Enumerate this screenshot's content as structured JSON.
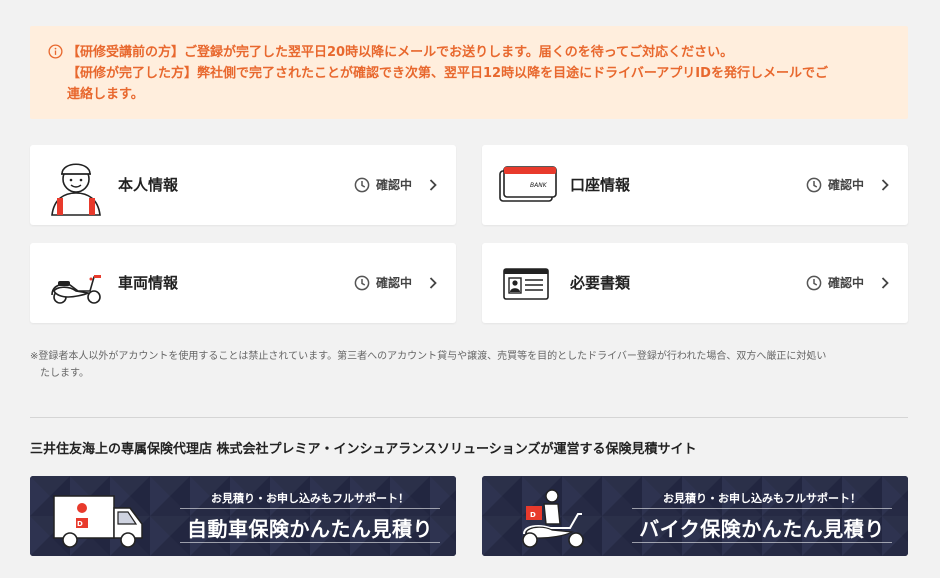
{
  "notice": {
    "lines": [
      "【研修受講前の方】ご登録が完了した翌平日20時以降にメールでお送りします。届くのを待ってご対応ください。",
      "【研修が完了した方】弊社側で完了されたことが確認でき次第、翌平日12時以降を目途にドライバーアプリIDを発行しメールでご",
      "連絡します。"
    ],
    "color": "#e8682e",
    "background": "#ffeedd"
  },
  "cards": [
    {
      "title": "本人情報",
      "status": "確認中",
      "icon": "driver-person-icon"
    },
    {
      "title": "口座情報",
      "status": "確認中",
      "icon": "bank-card-icon"
    },
    {
      "title": "車両情報",
      "status": "確認中",
      "icon": "scooter-icon"
    },
    {
      "title": "必要書類",
      "status": "確認中",
      "icon": "id-card-icon"
    }
  ],
  "disclaimer": {
    "line1": "※登録者本人以外がアカウントを使用することは禁止されています。第三者へのアカウント貸与や譲渡、売買等を目的としたドライバー登録が行われた場合、双方へ厳正に対処い",
    "line2": "たします。"
  },
  "agency_text": "三井住友海上の専属保険代理店 株式会社プレミア・インシュアランスソリューションズが運営する保険見積サイト",
  "banners": [
    {
      "sub": "お見積り・お申し込みもフルサポート！",
      "main": "自動車保険かんたん見積り",
      "icon": "delivery-van-icon"
    },
    {
      "sub": "お見積り・お申し込みもフルサポート！",
      "main": "バイク保険かんたん見積り",
      "icon": "delivery-scooter-icon"
    }
  ],
  "colors": {
    "accent": "#e83a2c",
    "banner_bg": "#262a44"
  }
}
